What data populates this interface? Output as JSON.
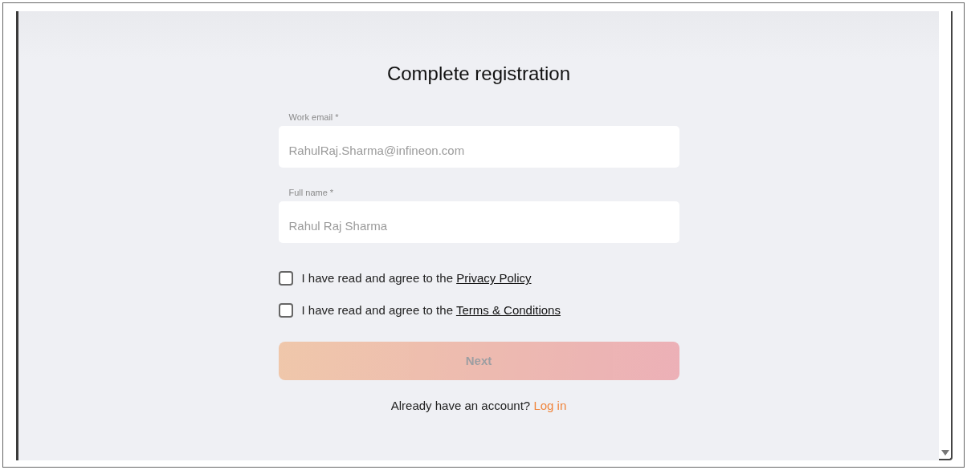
{
  "title": "Complete registration",
  "fields": [
    {
      "label": "Work email *",
      "value": "RahulRaj.Sharma@infineon.com",
      "disabled": true
    },
    {
      "label": "Full name *",
      "value": "Rahul Raj Sharma",
      "disabled": true
    }
  ],
  "agreements": [
    {
      "text": "I have read and agree to the ",
      "link": "Privacy Policy",
      "checked": false
    },
    {
      "text": "I have read and agree to the ",
      "link": "Terms & Conditions",
      "checked": false
    }
  ],
  "next_button": {
    "label": "Next",
    "disabled": true
  },
  "login_prompt": {
    "text": "Already have an account? ",
    "link": "Log in"
  }
}
